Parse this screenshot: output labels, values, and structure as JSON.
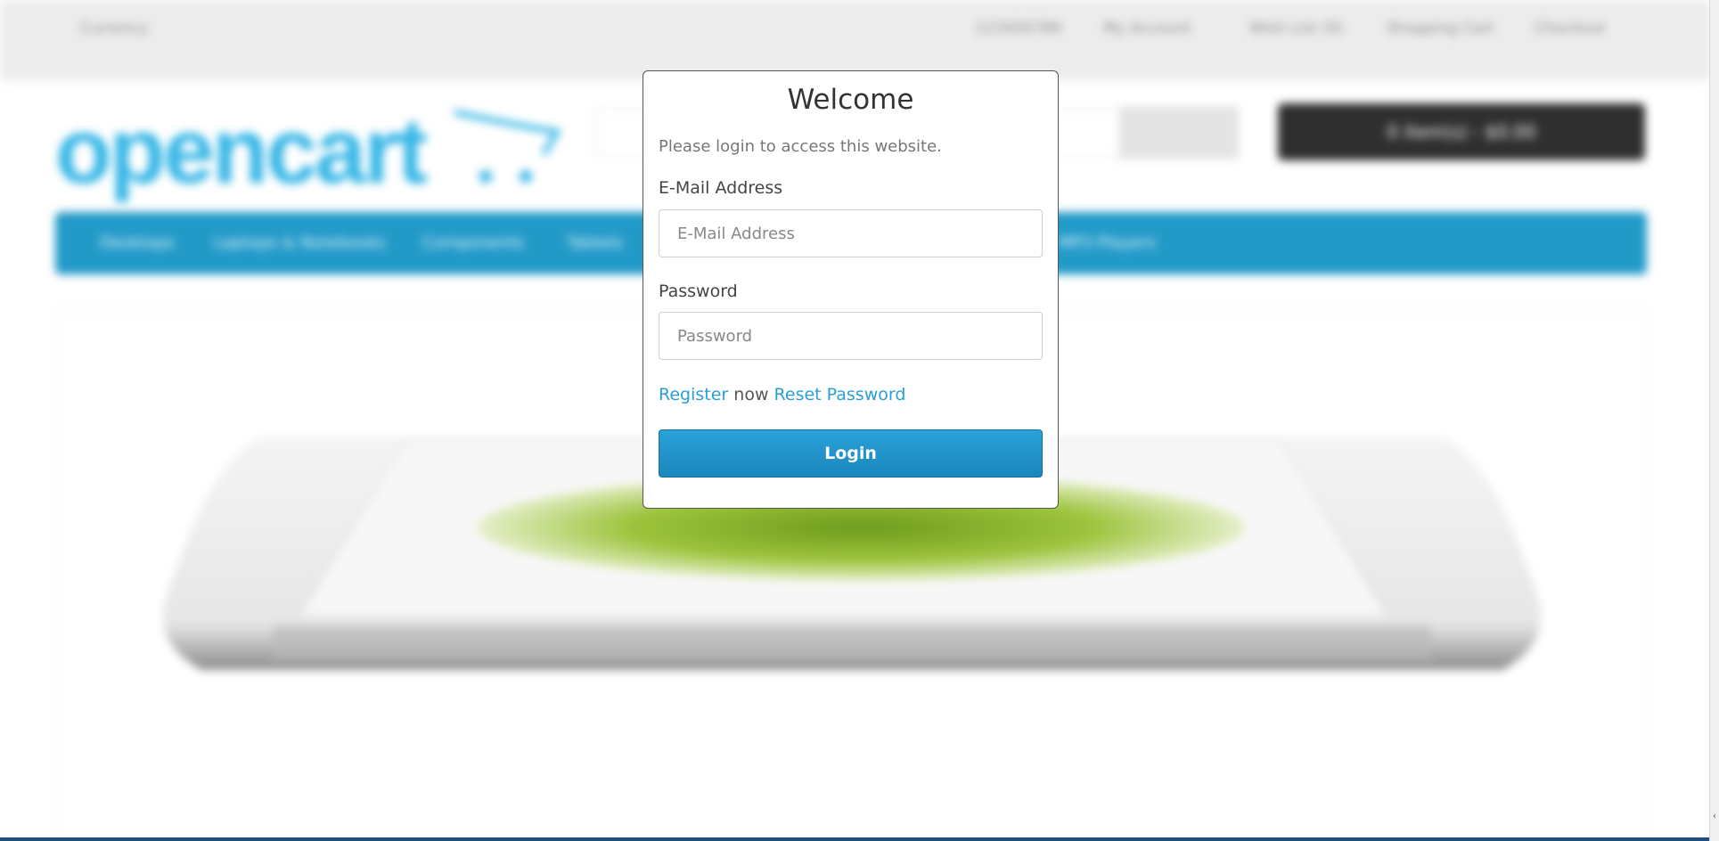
{
  "background": {
    "top_bar_items": [
      "123456789",
      "My Account",
      "Wish List (0)",
      "Shopping Cart",
      "Checkout"
    ],
    "currency_label": "Currency",
    "logo_text": "opencart",
    "cart_button_label": "0 item(s) - $0.00",
    "menu_items": [
      "Desktops",
      "Laptops & Notebooks",
      "Components",
      "Tablets",
      "MP3 Players"
    ],
    "accent_color": "#229ac8"
  },
  "modal": {
    "title": "Welcome",
    "subtitle": "Please login to access this website.",
    "email": {
      "label": "E-Mail Address",
      "placeholder": "E-Mail Address",
      "value": ""
    },
    "password": {
      "label": "Password",
      "placeholder": "Password",
      "value": ""
    },
    "register_link": "Register",
    "now_text": " now ",
    "reset_link": "Reset Password",
    "login_button": "Login",
    "link_color": "#2a9fd6",
    "button_color": "#229ac8"
  }
}
